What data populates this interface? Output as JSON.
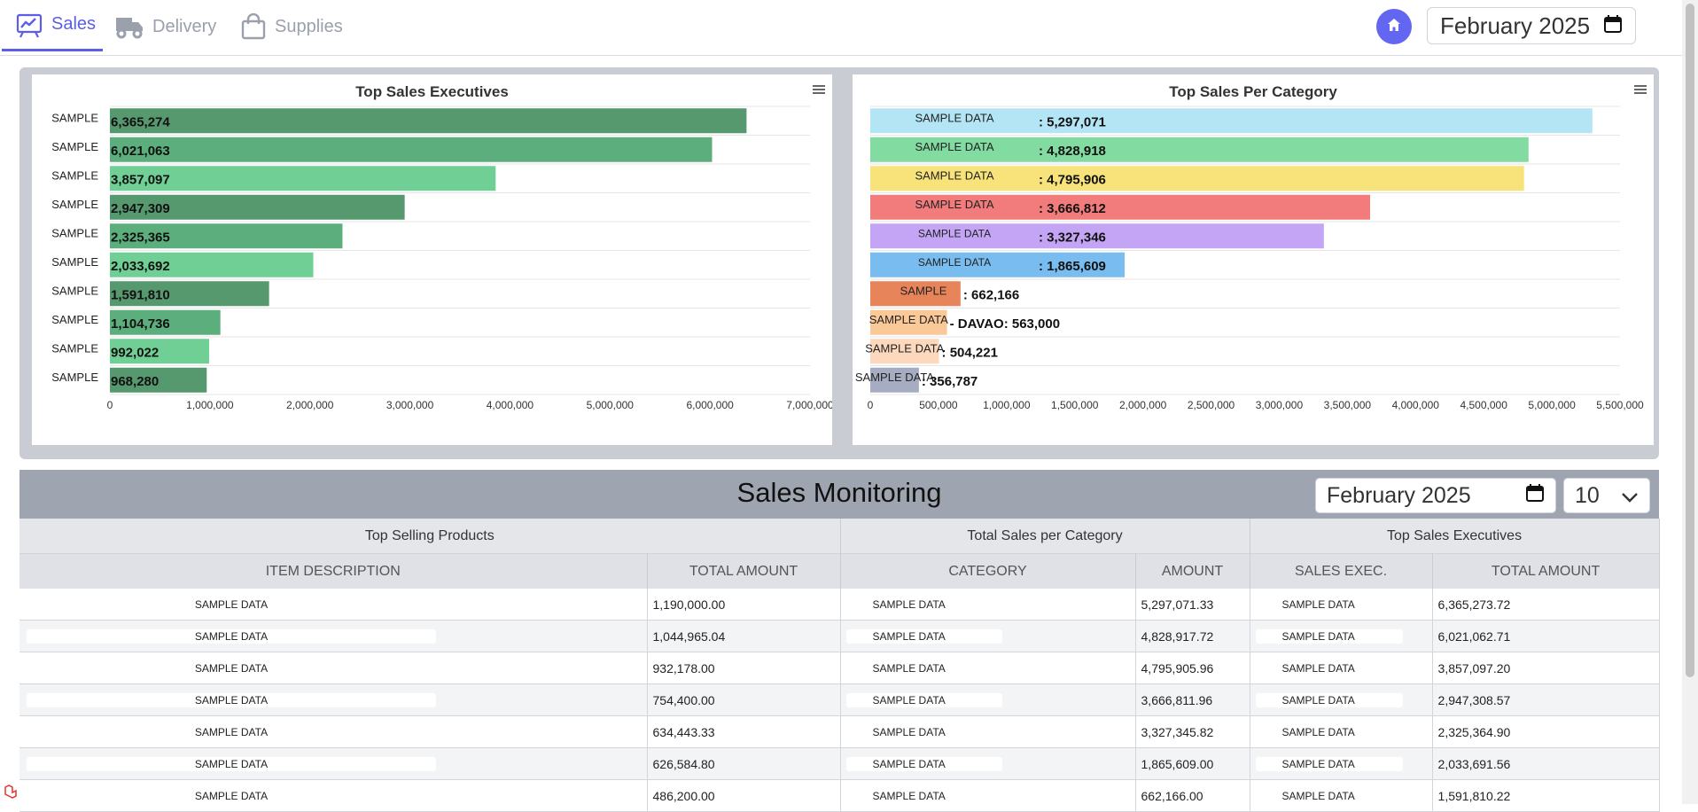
{
  "nav": {
    "tabs": [
      {
        "label": "Sales",
        "active": true
      },
      {
        "label": "Delivery",
        "active": false
      },
      {
        "label": "Supplies",
        "active": false
      }
    ],
    "date_value": "February 2025"
  },
  "chart_data": [
    {
      "type": "bar",
      "orientation": "horizontal",
      "title": "Top Sales Executives",
      "categories": [
        "SAMPLE",
        "SAMPLE",
        "SAMPLE",
        "SAMPLE",
        "SAMPLE",
        "SAMPLE",
        "SAMPLE",
        "SAMPLE",
        "SAMPLE",
        "SAMPLE"
      ],
      "values": [
        6365274,
        6021063,
        3857097,
        2947309,
        2325365,
        2033692,
        1591810,
        1104736,
        992022,
        968280
      ],
      "data_labels": [
        "6,365,274",
        "6,021,063",
        "3,857,097",
        "2,947,309",
        "2,325,365",
        "2,033,692",
        "1,591,810",
        "1,104,736",
        "992,022",
        "968,280"
      ],
      "xlim": [
        0,
        7000000
      ],
      "x_ticks": [
        "0",
        "1,000,000",
        "2,000,000",
        "3,000,000",
        "4,000,000",
        "5,000,000",
        "6,000,000",
        "7,000,000"
      ],
      "colors": [
        "#57996f",
        "#5caf7d",
        "#6fcf94",
        "#57996f",
        "#5caf7d",
        "#6fcf94",
        "#57996f",
        "#5caf7d",
        "#6fcf94",
        "#57996f"
      ],
      "grid": true
    },
    {
      "type": "bar",
      "orientation": "horizontal",
      "title": "Top Sales Per Category",
      "categories": [
        "SAMPLE DATA",
        "SAMPLE DATA",
        "SAMPLE DATA",
        "SAMPLE DATA",
        "SAMPLE DATA",
        "SAMPLE DATA",
        "SAMPLE",
        "SAMPLE DATA",
        "SAMPLE DATA",
        "SAMPLE DATA"
      ],
      "values": [
        5297071,
        4828918,
        4795906,
        3666812,
        3327346,
        1865609,
        662166,
        563000,
        504221,
        356787
      ],
      "data_labels": [
        ": 5,297,071",
        ": 4,828,918",
        ": 4,795,906",
        ": 3,666,812",
        ": 3,327,346",
        ": 1,865,609",
        ": 662,166",
        "- DAVAO: 563,000",
        ": 504,221",
        ": 356,787"
      ],
      "xlim": [
        0,
        5500000
      ],
      "x_ticks": [
        "0",
        "500,000",
        "1,000,000",
        "1,500,000",
        "2,000,000",
        "2,500,000",
        "3,000,000",
        "3,500,000",
        "4,000,000",
        "4,500,000",
        "5,000,000",
        "5,500,000"
      ],
      "colors": [
        "#b3e5f5",
        "#82dba0",
        "#f7e37a",
        "#f27c7c",
        "#c4a5f5",
        "#78bcf0",
        "#e8845a",
        "#fbc998",
        "#fcd9bc",
        "#a6adc2"
      ],
      "grid": true
    }
  ],
  "monitoring": {
    "title": "Sales Monitoring",
    "date_value": "February 2025",
    "page_size": "10",
    "groups": [
      "Top Selling Products",
      "Total Sales per Category",
      "Top Sales Executives"
    ],
    "columns": [
      "ITEM DESCRIPTION",
      "TOTAL AMOUNT",
      "CATEGORY",
      "AMOUNT",
      "SALES EXEC.",
      "TOTAL AMOUNT"
    ],
    "rows": [
      {
        "item": "SAMPLE DATA",
        "item_amount": "1,190,000.00",
        "category": "SAMPLE DATA",
        "cat_amount": "5,297,071.33",
        "exec": "SAMPLE DATA",
        "exec_amount": "6,365,273.72"
      },
      {
        "item": "SAMPLE DATA",
        "item_amount": "1,044,965.04",
        "category": "SAMPLE DATA",
        "cat_amount": "4,828,917.72",
        "exec": "SAMPLE DATA",
        "exec_amount": "6,021,062.71"
      },
      {
        "item": "SAMPLE DATA",
        "item_amount": "932,178.00",
        "category": "SAMPLE DATA",
        "cat_amount": "4,795,905.96",
        "exec": "SAMPLE DATA",
        "exec_amount": "3,857,097.20"
      },
      {
        "item": "SAMPLE DATA",
        "item_amount": "754,400.00",
        "category": "SAMPLE DATA",
        "cat_amount": "3,666,811.96",
        "exec": "SAMPLE DATA",
        "exec_amount": "2,947,308.57"
      },
      {
        "item": "SAMPLE DATA",
        "item_amount": "634,443.33",
        "category": "SAMPLE DATA",
        "cat_amount": "3,327,345.82",
        "exec": "SAMPLE DATA",
        "exec_amount": "2,325,364.90"
      },
      {
        "item": "SAMPLE DATA",
        "item_amount": "626,584.80",
        "category": "SAMPLE DATA",
        "cat_amount": "1,865,609.00",
        "exec": "SAMPLE DATA",
        "exec_amount": "2,033,691.56"
      },
      {
        "item": "SAMPLE DATA",
        "item_amount": "486,200.00",
        "category": "SAMPLE DATA",
        "cat_amount": "662,166.00",
        "exec": "SAMPLE DATA",
        "exec_amount": "1,591,810.22"
      }
    ]
  }
}
